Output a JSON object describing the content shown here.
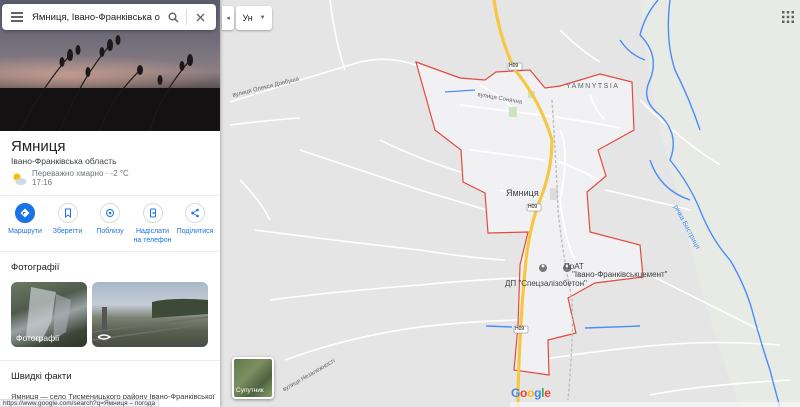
{
  "search": {
    "value": "Ямниця, Івано-Франківська обл"
  },
  "layer_select": {
    "value": "Ун"
  },
  "place": {
    "title": "Ямниця",
    "subtitle": "Івано-Франківська область",
    "weather": "Переважно хмарно · -2 °C",
    "time": "17:16"
  },
  "actions": [
    {
      "label": "Маршрути"
    },
    {
      "label": "Зберегти"
    },
    {
      "label": "Поблизу"
    },
    {
      "label": "Надіслати на телефон"
    },
    {
      "label": "Поділитися"
    }
  ],
  "photos_section": {
    "title": "Фотографії",
    "photo1_label": "Фотографії"
  },
  "facts_section": {
    "title": "Швидкі факти",
    "text": "Ямниця — село Тисменицького району Івано-Франківської"
  },
  "status_url": "https://www.google.com/search?q=Ямниця – погода",
  "map": {
    "labels": {
      "town_latin": "YAMNYTSIA",
      "town": "Ямниця",
      "poi1_line1": "ПрАТ",
      "poi1_line2": "\"Івано-Франківськцемент\"",
      "poi2": "ДП \"Спецзалізобетон\"",
      "river": "річка Бистриця",
      "road_h09_a": "H09",
      "road_h09_b": "H09",
      "road_h09_c": "H09",
      "street1": "вулиця Олекси Довбуша",
      "street2": "вулиця Сонячна",
      "street3": "вулиця Незалежності"
    },
    "satellite_label": "Супутник",
    "google_logo": "Google",
    "colors": {
      "boundary": "#e34a3e",
      "highway": "#f6c744",
      "water": "#4a8df8",
      "land": "#e5e5e5",
      "area": "#f1f1f3"
    }
  }
}
